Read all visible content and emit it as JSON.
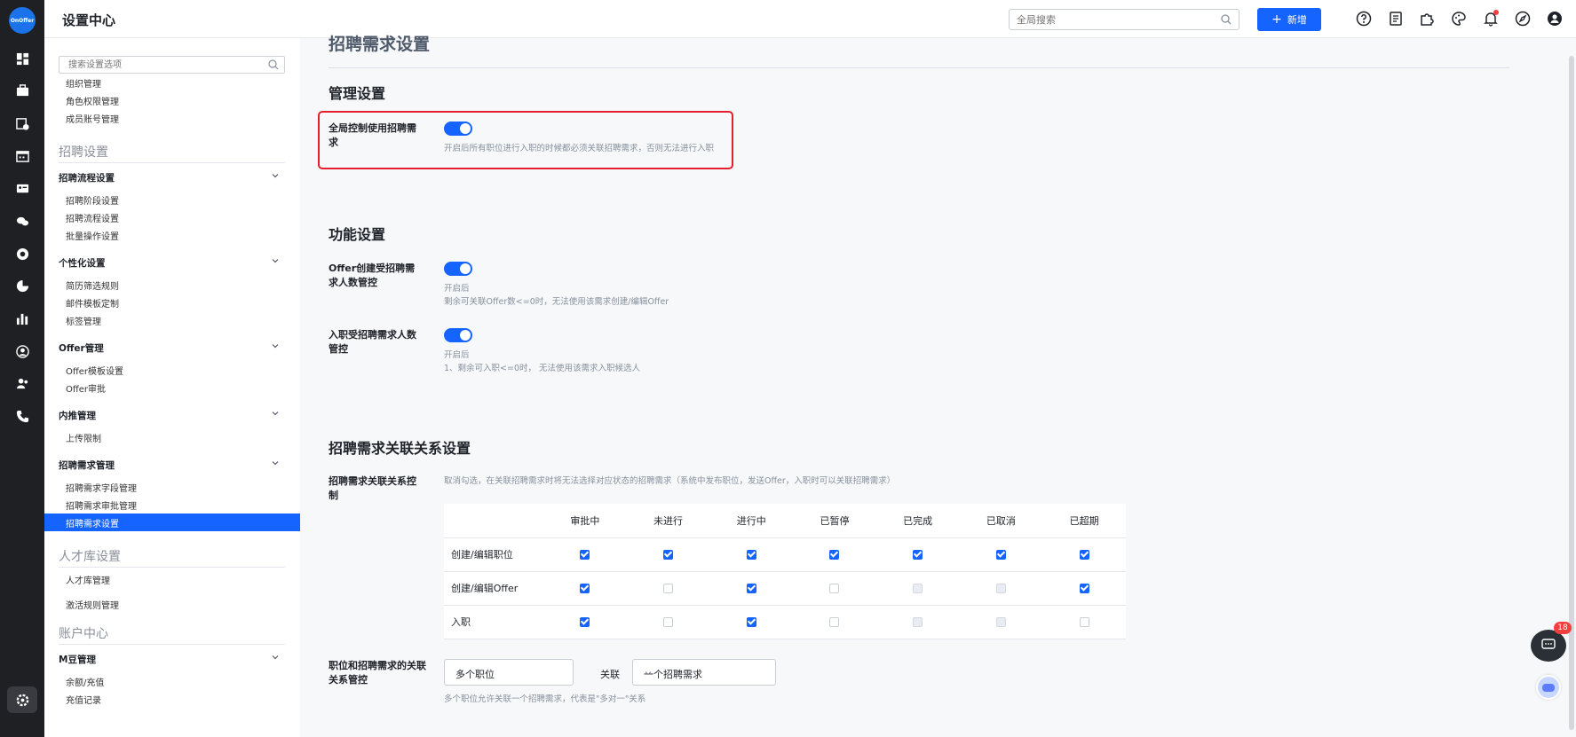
{
  "rail": {
    "logo": "OnOffer",
    "icons": [
      "dashboard-icon",
      "briefcase-icon",
      "calendar-check-icon",
      "calendar-icon",
      "id-card-icon",
      "wechat-icon",
      "report-icon",
      "pie-chart-icon",
      "bar-chart-icon",
      "talent-icon",
      "team-icon",
      "phone-icon"
    ],
    "settings_icon": "settings-icon"
  },
  "topbar": {
    "title": "设置中心",
    "search_placeholder": "全局搜索",
    "new_label": "新增",
    "icons": [
      "help-icon",
      "document-icon",
      "plugin-icon",
      "theme-icon",
      "bell-icon",
      "compass-icon",
      "user-icon"
    ]
  },
  "sidebar": {
    "search_placeholder": "搜索设置选项",
    "top_items": [
      "组织管理",
      "角色权限管理",
      "成员账号管理"
    ],
    "recruit_group": "招聘设置",
    "sections": [
      {
        "title": "招聘流程设置",
        "items": [
          "招聘阶段设置",
          "招聘流程设置",
          "批量操作设置"
        ]
      },
      {
        "title": "个性化设置",
        "items": [
          "简历筛选规则",
          "邮件模板定制",
          "标签管理"
        ]
      },
      {
        "title": "Offer管理",
        "items": [
          "Offer模板设置",
          "Offer审批"
        ]
      },
      {
        "title": "内推管理",
        "items": [
          "上传限制"
        ]
      },
      {
        "title": "招聘需求管理",
        "items": [
          "招聘需求字段管理",
          "招聘需求审批管理",
          "招聘需求设置"
        ]
      }
    ],
    "talent_group": "人才库设置",
    "talent_items": [
      "人才库管理",
      "激活规则管理"
    ],
    "account_group": "账户中心",
    "account_section": {
      "title": "M豆管理",
      "items": [
        "余额/充值",
        "充值记录"
      ]
    },
    "active_item": "招聘需求设置"
  },
  "main": {
    "page_title": "招聘需求设置",
    "mgmt": {
      "heading": "管理设置",
      "global_label": "全局控制使用招聘需求",
      "global_on": true,
      "global_desc": "开启后所有职位进行入职的时候都必须关联招聘需求，否则无法进行入职"
    },
    "func": {
      "heading": "功能设置",
      "offer_label": "Offer创建受招聘需求人数管控",
      "offer_on": true,
      "offer_desc1": "开启后",
      "offer_desc2": "剩余可关联Offer数<=0时，无法使用该需求创建/编辑Offer",
      "onboard_label": "入职受招聘需求人数管控",
      "onboard_on": true,
      "onboard_desc1": "开启后",
      "onboard_desc2": "1、剩余可入职<=0时， 无法使用该需求入职候选人"
    },
    "relation": {
      "heading": "招聘需求关联关系设置",
      "control_label": "招聘需求关联关系控制",
      "control_desc": "取消勾选，在关联招聘需求时将无法选择对应状态的招聘需求（系统中发布职位，发送Offer，入职时可以关联招聘需求）",
      "columns": [
        "审批中",
        "未进行",
        "进行中",
        "已暂停",
        "已完成",
        "已取消",
        "已超期"
      ],
      "rows": [
        {
          "label": "创建/编辑职位",
          "cells": [
            "on",
            "on",
            "on",
            "on",
            "on",
            "on",
            "on"
          ]
        },
        {
          "label": "创建/编辑Offer",
          "cells": [
            "on",
            "off",
            "on",
            "off",
            "dis",
            "dis",
            "on"
          ]
        },
        {
          "label": "入职",
          "cells": [
            "on",
            "off",
            "on",
            "off",
            "dis",
            "dis",
            "off"
          ]
        }
      ],
      "position_label": "职位和招聘需求的关联关系管控",
      "select1": "多个职位",
      "link_text": "关联",
      "select2": "一个招聘需求",
      "position_desc": "多个职位允许关联一个招聘需求，代表是\"多对一\"关系"
    }
  },
  "widgets": {
    "chat_badge": "18"
  }
}
